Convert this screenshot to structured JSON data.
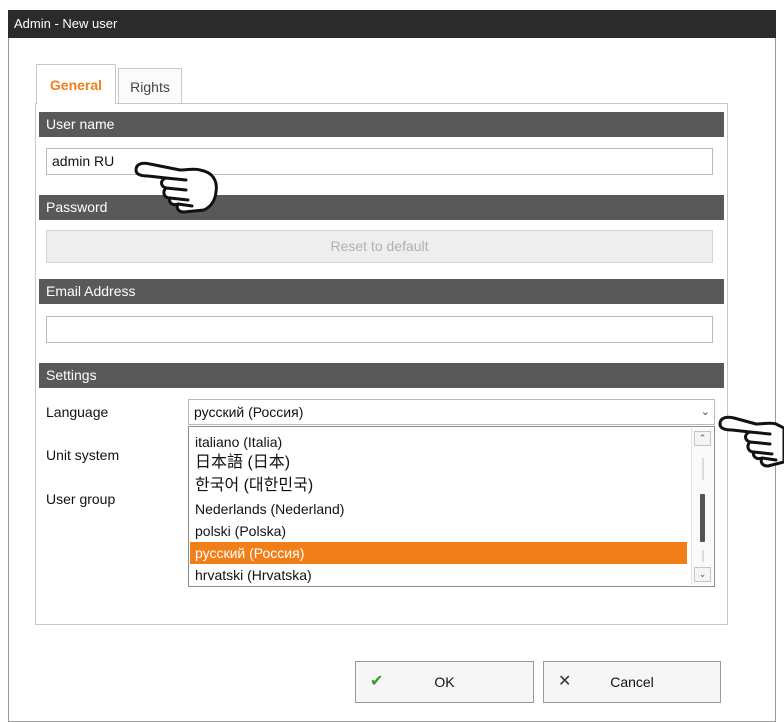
{
  "window": {
    "title": "Admin - New user"
  },
  "tabs": [
    {
      "label": "General",
      "active": true
    },
    {
      "label": "Rights",
      "active": false
    }
  ],
  "sections": {
    "user_name": {
      "title": "User name",
      "value": "admin RU"
    },
    "password": {
      "title": "Password",
      "reset_label": "Reset to default"
    },
    "email": {
      "title": "Email Address",
      "value": ""
    },
    "settings": {
      "title": "Settings",
      "language_label": "Language",
      "unit_system_label": "Unit system",
      "user_group_label": "User group",
      "language_selected": "русский (Россия)",
      "language_options": [
        "italiano (Italia)",
        "日本語 (日本)",
        "한국어 (대한민국)",
        "Nederlands (Nederland)",
        "polski (Polska)",
        "русский (Россия)",
        "hrvatski (Hrvatska)"
      ]
    }
  },
  "buttons": {
    "ok_label": "OK",
    "cancel_label": "Cancel"
  },
  "icons": {
    "ok": "check-icon",
    "cancel": "close-icon",
    "pointer": "pointing-hand-icon",
    "select_arrow": "chevron-down-icon"
  },
  "colors": {
    "accent": "#f07f1a",
    "titlebar": "#2b2b2b",
    "section_header": "#595959",
    "ok_check": "#3a9b2a"
  }
}
